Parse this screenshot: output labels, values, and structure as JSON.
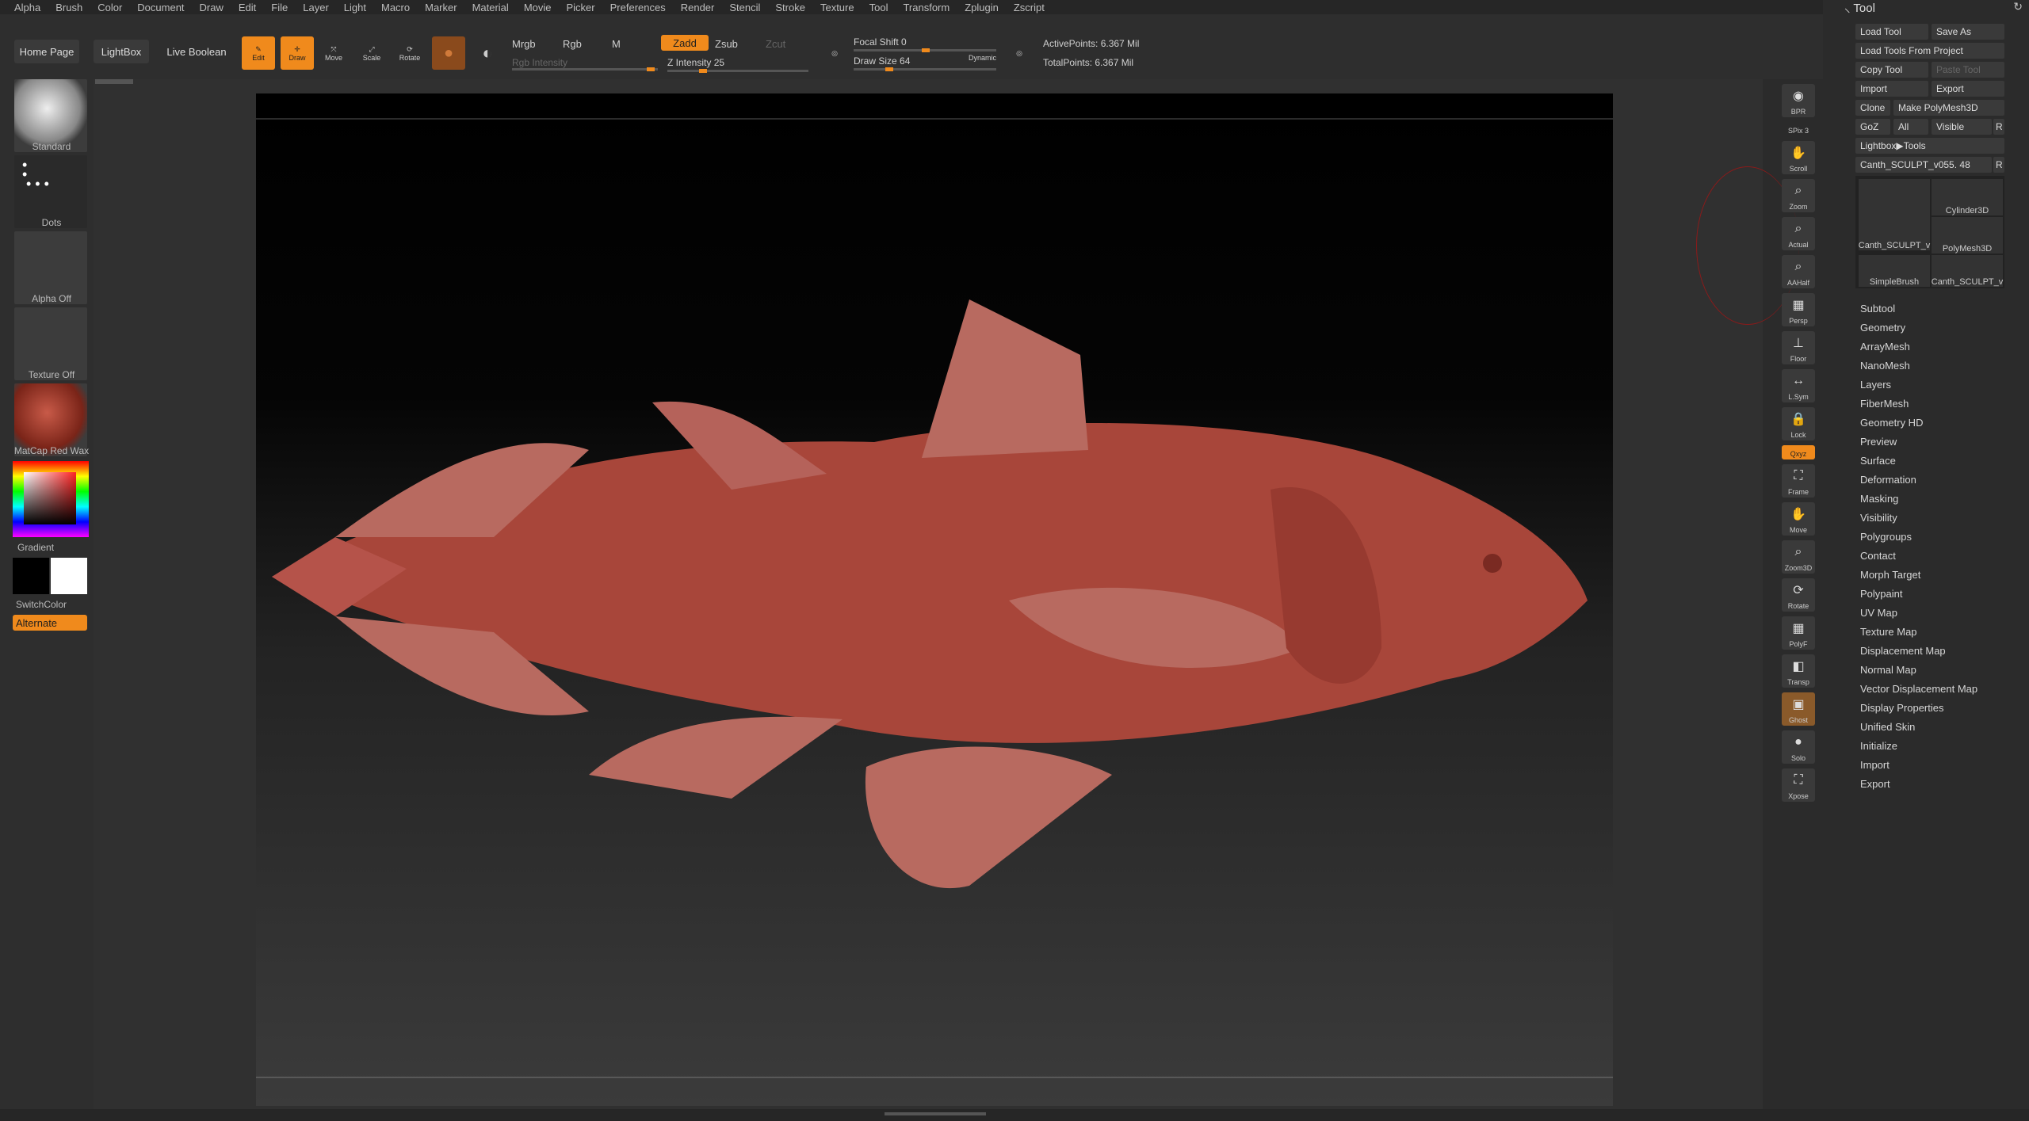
{
  "menu": [
    "Alpha",
    "Brush",
    "Color",
    "Document",
    "Draw",
    "Edit",
    "File",
    "Layer",
    "Light",
    "Macro",
    "Marker",
    "Material",
    "Movie",
    "Picker",
    "Preferences",
    "Render",
    "Stencil",
    "Stroke",
    "Texture",
    "Tool",
    "Transform",
    "Zplugin",
    "Zscript"
  ],
  "topbar": {
    "home_page": "Home Page",
    "lightbox": "LightBox",
    "live_boolean": "Live Boolean",
    "edit": "Edit",
    "draw": "Draw",
    "move": "Move",
    "scale": "Scale",
    "rotate": "Rotate",
    "mrgb": "Mrgb",
    "rgb": "Rgb",
    "m": "M",
    "rgb_intensity": "Rgb Intensity",
    "zadd": "Zadd",
    "zsub": "Zsub",
    "zcut": "Zcut",
    "z_intensity": "Z Intensity 25",
    "focal_shift": "Focal Shift 0",
    "draw_size": "Draw Size 64",
    "dynamic": "Dynamic",
    "active_points": "ActivePoints: 6.367 Mil",
    "total_points": "TotalPoints: 6.367 Mil",
    "z_intensity_value": 25,
    "focal_shift_value": 0,
    "draw_size_value": 64
  },
  "left_shelf": {
    "brush": "Standard",
    "stroke": "Dots",
    "alpha": "Alpha Off",
    "texture": "Texture Off",
    "material": "MatCap Red Wax",
    "gradient": "Gradient",
    "switch_color": "SwitchColor",
    "alternate": "Alternate"
  },
  "right_shelf": [
    "BPR",
    "SPix 3",
    "Scroll",
    "Zoom",
    "Actual",
    "AAHalf",
    "Persp",
    "Floor",
    "L.Sym",
    "Lock",
    "Qxyz",
    "Frame",
    "Move",
    "Zoom3D",
    "Rotate",
    "PolyF",
    "Transp",
    "Ghost",
    "Solo",
    "Xpose"
  ],
  "tool_palette": {
    "title": "Tool",
    "buttons": {
      "load_tool": "Load Tool",
      "save_as": "Save As",
      "load_from_project": "Load Tools From Project",
      "copy_tool": "Copy Tool",
      "paste_tool": "Paste Tool",
      "import": "Import",
      "export": "Export",
      "clone": "Clone",
      "make_polymesh": "Make PolyMesh3D",
      "goz": "GoZ",
      "all": "All",
      "visible": "Visible",
      "r": "R",
      "lightbox_tools": "Lightbox▶Tools",
      "current_tool": "Canth_SCULPT_v055. 48"
    },
    "thumbnails": [
      "Canth_SCULPT_v",
      "Cylinder3D",
      "PolyMesh3D",
      "SimpleBrush",
      "Canth_SCULPT_v"
    ],
    "sections": [
      "Subtool",
      "Geometry",
      "ArrayMesh",
      "NanoMesh",
      "Layers",
      "FiberMesh",
      "Geometry HD",
      "Preview",
      "Surface",
      "Deformation",
      "Masking",
      "Visibility",
      "Polygroups",
      "Contact",
      "Morph Target",
      "Polypaint",
      "UV Map",
      "Texture Map",
      "Displacement Map",
      "Normal Map",
      "Vector Displacement Map",
      "Display Properties",
      "Unified Skin",
      "Initialize",
      "Import",
      "Export"
    ]
  }
}
